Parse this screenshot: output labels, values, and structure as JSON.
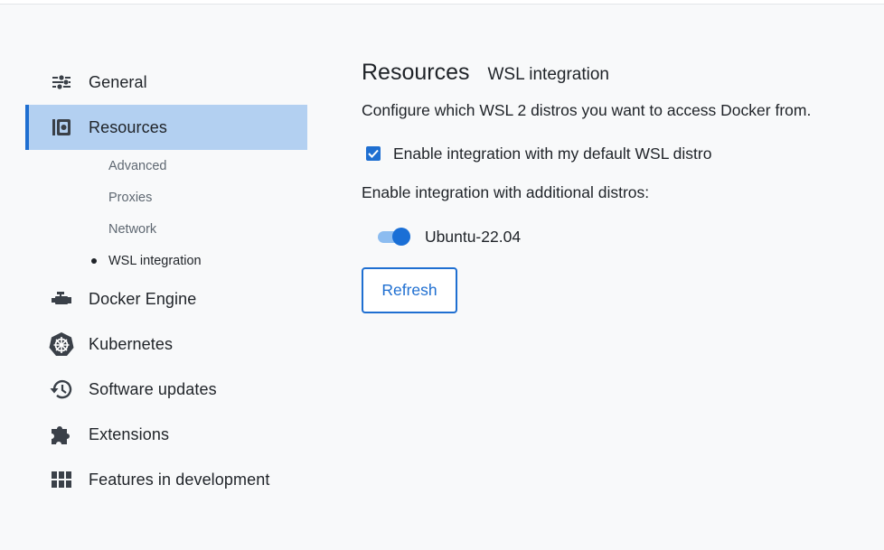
{
  "sidebar": {
    "items": [
      {
        "label": "General",
        "icon": "sliders-icon"
      },
      {
        "label": "Resources",
        "icon": "resources-icon",
        "active": true
      },
      {
        "label": "Docker Engine",
        "icon": "engine-icon"
      },
      {
        "label": "Kubernetes",
        "icon": "kubernetes-icon"
      },
      {
        "label": "Software updates",
        "icon": "history-icon"
      },
      {
        "label": "Extensions",
        "icon": "puzzle-icon"
      },
      {
        "label": "Features in development",
        "icon": "grid-icon"
      }
    ],
    "resources_sub": [
      {
        "label": "Advanced"
      },
      {
        "label": "Proxies"
      },
      {
        "label": "Network"
      },
      {
        "label": "WSL integration",
        "current": true
      }
    ]
  },
  "content": {
    "title": "Resources",
    "subtitle": "WSL integration",
    "description": "Configure which WSL 2 distros you want to access Docker from.",
    "default_distro_label": "Enable integration with my default WSL distro",
    "default_distro_checked": true,
    "additional_label": "Enable integration with additional distros:",
    "distros": [
      {
        "name": "Ubuntu-22.04",
        "enabled": true
      }
    ],
    "refresh_label": "Refresh"
  },
  "colors": {
    "accent": "#1f6fd1",
    "active_bg": "#b3d0f1",
    "background": "#f8f9fa"
  }
}
